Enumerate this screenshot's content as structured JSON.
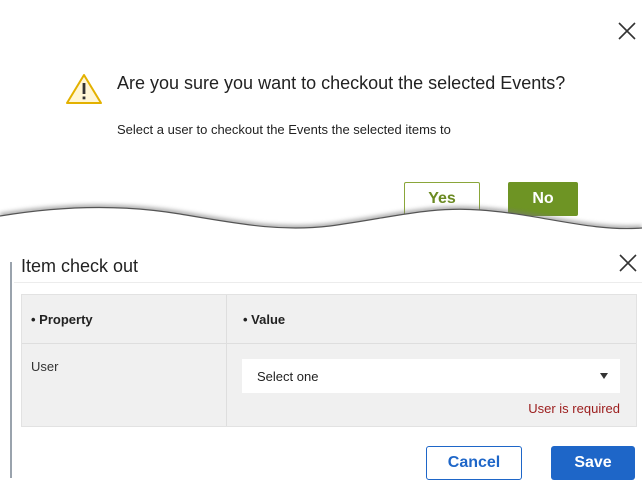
{
  "confirm_dialog": {
    "title": "Are you sure you want to checkout the selected Events?",
    "subtitle": "Select a user to checkout the Events the selected items to",
    "yes_label": "Yes",
    "no_label": "No",
    "icon": "warning-icon",
    "accent_color": "#6e9424"
  },
  "checkout_dialog": {
    "title": "Item check out",
    "table": {
      "headers": [
        "• Property",
        "• Value"
      ],
      "rows": [
        {
          "property": "User",
          "value_placeholder": "Select one",
          "error": "User is required"
        }
      ]
    },
    "cancel_label": "Cancel",
    "save_label": "Save",
    "accent_color": "#1e66c8",
    "error_color": "#9b1c1c"
  }
}
